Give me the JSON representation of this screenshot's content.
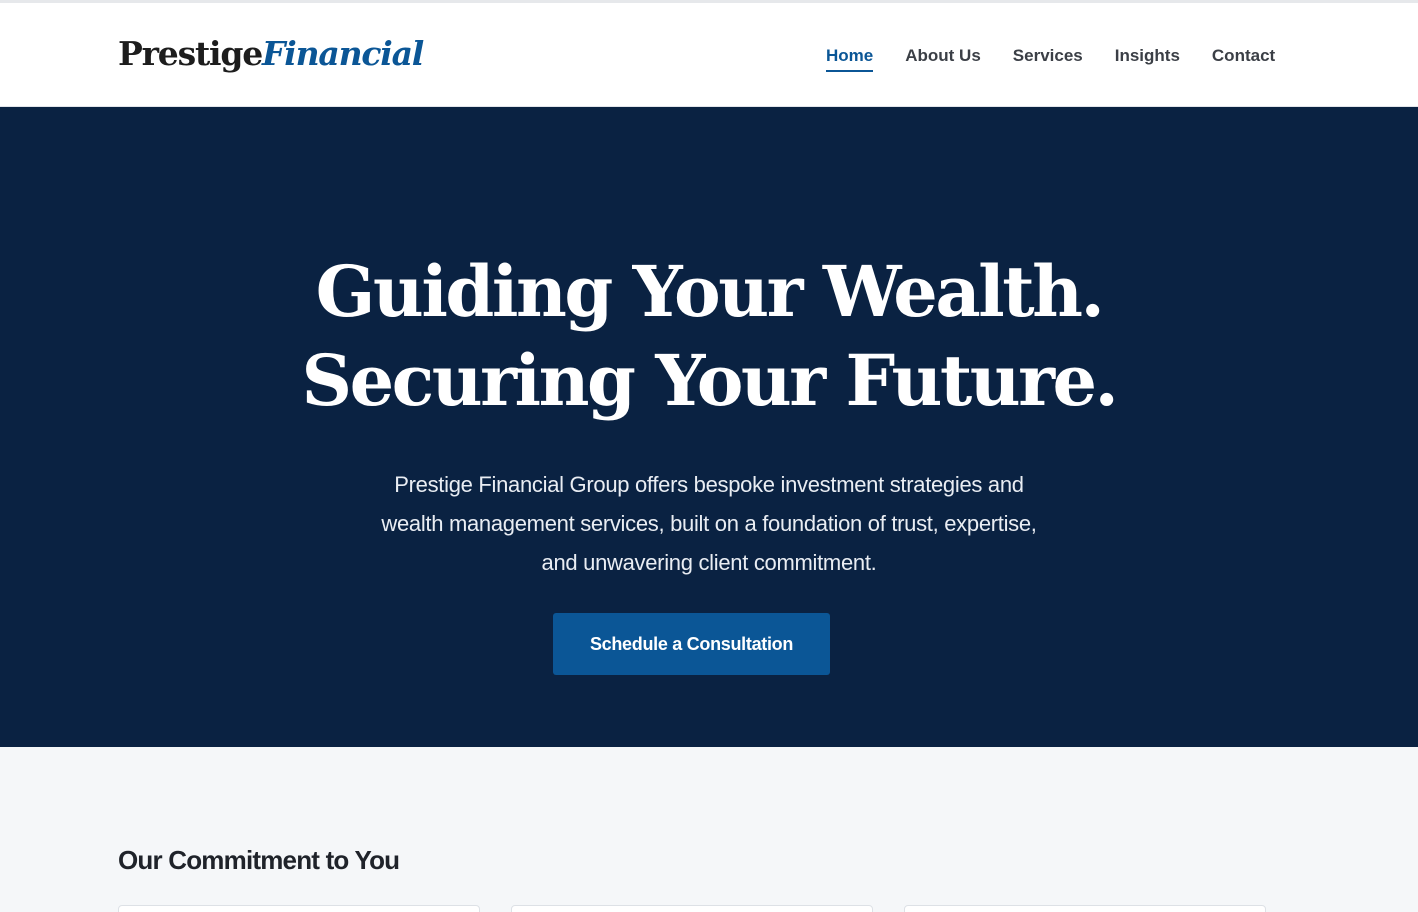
{
  "brand": {
    "logo_primary": "Prestige",
    "logo_secondary": "Financial"
  },
  "nav": {
    "items": [
      {
        "label": "Home",
        "active": true
      },
      {
        "label": "About Us",
        "active": false
      },
      {
        "label": "Services",
        "active": false
      },
      {
        "label": "Insights",
        "active": false
      },
      {
        "label": "Contact",
        "active": false
      }
    ]
  },
  "hero": {
    "title_line1": "Guiding Your Wealth.",
    "title_line2": "Securing Your Future.",
    "subtitle_line1": "Prestige Financial Group offers bespoke investment strategies and",
    "subtitle_line2": "wealth management services, built on a foundation of trust, expertise,",
    "subtitle_line3": "and unwavering client commitment.",
    "cta_label": "Schedule a Consultation"
  },
  "commitment": {
    "title": "Our Commitment to You"
  },
  "colors": {
    "navy": "#0a2242",
    "accent_blue": "#0b5696",
    "section_bg": "#f5f7f9"
  }
}
